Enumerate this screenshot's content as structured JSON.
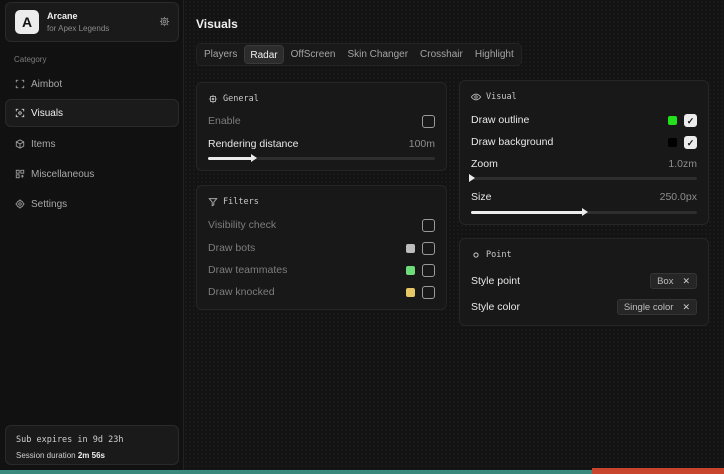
{
  "app": {
    "name": "Arcane",
    "subtitle": "for Apex Legends",
    "logo_letter": "A"
  },
  "sidebar": {
    "category_label": "Category",
    "items": [
      {
        "label": "Aimbot",
        "icon": "crosshair-icon",
        "active": false
      },
      {
        "label": "Visuals",
        "icon": "eye-scan-icon",
        "active": true
      },
      {
        "label": "Items",
        "icon": "cube-icon",
        "active": false
      },
      {
        "label": "Miscellaneous",
        "icon": "grid-icon",
        "active": false
      },
      {
        "label": "Settings",
        "icon": "gear-icon",
        "active": false
      }
    ],
    "subscription": {
      "expires_text": "Sub expires in 9d 23h",
      "session_label": "Session duration",
      "session_value": "2m 56s"
    }
  },
  "main": {
    "title": "Visuals",
    "tabs": [
      "Players",
      "Radar",
      "OffScreen",
      "Skin Changer",
      "Crosshair",
      "Highlight"
    ],
    "active_tab": "Radar",
    "general": {
      "title": "General",
      "enable_label": "Enable",
      "enable_checked": false,
      "rendering_label": "Rendering distance",
      "rendering_value": "100m",
      "rendering_fraction": 0.2
    },
    "filters": {
      "title": "Filters",
      "items": [
        {
          "label": "Visibility check",
          "checked": false,
          "color": null
        },
        {
          "label": "Draw bots",
          "checked": false,
          "color": "#bdbdbd"
        },
        {
          "label": "Draw teammates",
          "checked": false,
          "color": "#6fdc7c"
        },
        {
          "label": "Draw knocked",
          "checked": false,
          "color": "#e6c766"
        }
      ]
    },
    "visual": {
      "title": "Visual",
      "outline_label": "Draw outline",
      "outline_color": "#22e01b",
      "outline_checked": true,
      "background_label": "Draw background",
      "background_color": "#000000",
      "background_checked": true,
      "zoom_label": "Zoom",
      "zoom_value": "1.0zm",
      "zoom_fraction": 0.0,
      "size_label": "Size",
      "size_value": "250.0px",
      "size_fraction": 0.5
    },
    "point": {
      "title": "Point",
      "style_point_label": "Style point",
      "style_point_value": "Box",
      "style_color_label": "Style color",
      "style_color_value": "Single color"
    }
  },
  "check_glyph": "✓",
  "remove_glyph": "✕"
}
